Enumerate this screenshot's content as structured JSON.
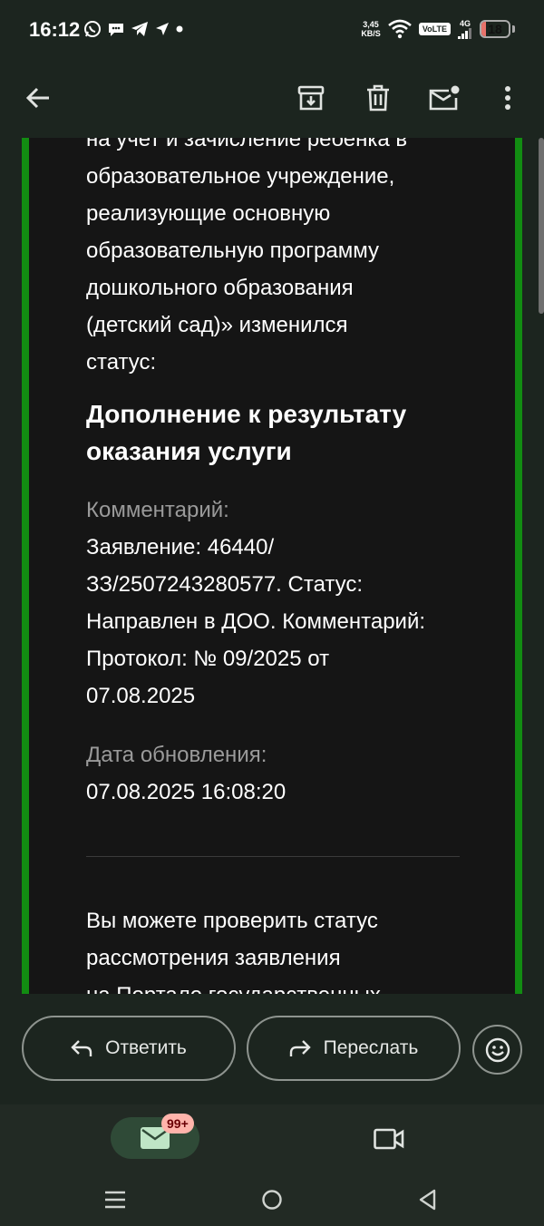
{
  "status_bar": {
    "time": "16:12",
    "net_speed_value": "3,45",
    "net_speed_unit": "KB/S",
    "volte": "VoLTE",
    "network": "4G",
    "battery": "18",
    "battery_level": 0.18
  },
  "toolbar": {
    "back_icon": "arrow-back-icon",
    "archive_icon": "archive-icon",
    "delete_icon": "trash-icon",
    "mark_unread_icon": "mail-unread-icon",
    "more_icon": "more-vert-icon"
  },
  "email": {
    "lines_top": [
      "на учет и зачисление ребенка в",
      "образовательное учреждение,",
      "реализующие основную",
      "образовательную программу",
      "дошкольного образования",
      "(детский сад)» изменился",
      "статус:"
    ],
    "status_heading_lines": [
      "Дополнение к результату",
      "оказания услуги"
    ],
    "comment_label": "Комментарий:",
    "comment_lines": [
      "Заявление: 46440/",
      "ЗЗ/2507243280577. Статус:",
      "Направлен в ДОО. Комментарий:",
      "Протокол: № 09/2025 от",
      "07.08.2025"
    ],
    "update_label": "Дата обновления:",
    "update_value": "07.08.2025 16:08:20",
    "footer_lines": [
      "Вы можете проверить статус",
      "рассмотрения заявления",
      "на Портале государственных"
    ]
  },
  "actions": {
    "reply_label": "Ответить",
    "forward_label": "Переслать"
  },
  "bottom_nav": {
    "mail_badge": "99+"
  },
  "colors": {
    "accent_border": "#128c12",
    "background": "#1c251f",
    "card": "#151515"
  }
}
